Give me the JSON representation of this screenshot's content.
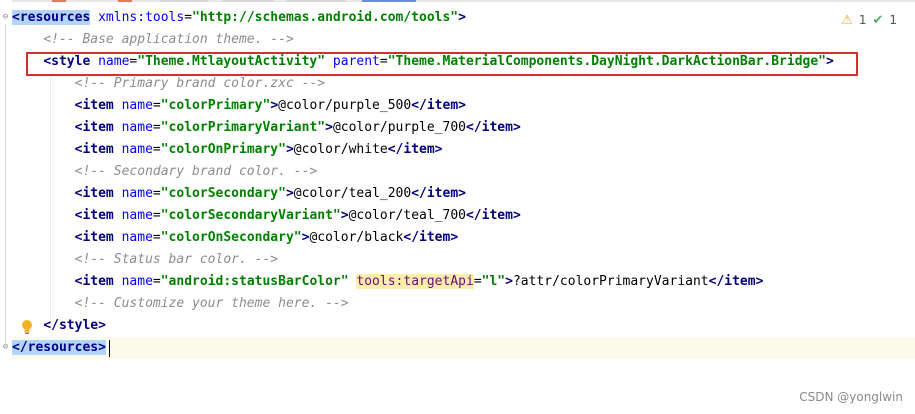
{
  "editor": {
    "lines": {
      "l1": {
        "open": "<resources",
        "ns_attr": "xmlns:tools",
        "eq": "=",
        "ns_val": "\"http://schemas.android.com/tools\"",
        "close": ">"
      },
      "l2": {
        "comment": "<!-- Base application theme. -->"
      },
      "l3": {
        "open": "<style",
        "a1": "name",
        "v1": "\"Theme.MtlayoutActivity\"",
        "a2": "parent",
        "v2": "\"Theme.MaterialComponents.DayNight.DarkActionBar.Bridge\"",
        "close": ">"
      },
      "l4": {
        "comment": "<!-- Primary brand color.zxc -->"
      },
      "l5": {
        "open": "<item",
        "a": "name",
        "v": "\"colorPrimary\"",
        "text": "@color/purple_500",
        "end": "</item>"
      },
      "l6": {
        "open": "<item",
        "a": "name",
        "v": "\"colorPrimaryVariant\"",
        "text": "@color/purple_700",
        "end": "</item>"
      },
      "l7": {
        "open": "<item",
        "a": "name",
        "v": "\"colorOnPrimary\"",
        "text": "@color/white",
        "end": "</item>"
      },
      "l8": {
        "comment": "<!-- Secondary brand color. -->"
      },
      "l9": {
        "open": "<item",
        "a": "name",
        "v": "\"colorSecondary\"",
        "text": "@color/teal_200",
        "end": "</item>"
      },
      "l10": {
        "open": "<item",
        "a": "name",
        "v": "\"colorSecondaryVariant\"",
        "text": "@color/teal_700",
        "end": "</item>"
      },
      "l11": {
        "open": "<item",
        "a": "name",
        "v": "\"colorOnSecondary\"",
        "text": "@color/black",
        "end": "</item>"
      },
      "l12": {
        "comment": "<!-- Status bar color. -->"
      },
      "l13": {
        "open": "<item",
        "a": "name",
        "v": "\"android:statusBarColor\"",
        "a2": "tools:targetApi",
        "v2": "\"l\"",
        "text": "?attr/colorPrimaryVariant",
        "end": "</item>"
      },
      "l14": {
        "comment": "<!-- Customize your theme here. -->"
      },
      "l15": {
        "end": "</style>"
      },
      "l16": {
        "end": "</resources>"
      }
    }
  },
  "inspections": {
    "warnings": "1",
    "ok": "1"
  },
  "watermark": "CSDN @yonglwin"
}
